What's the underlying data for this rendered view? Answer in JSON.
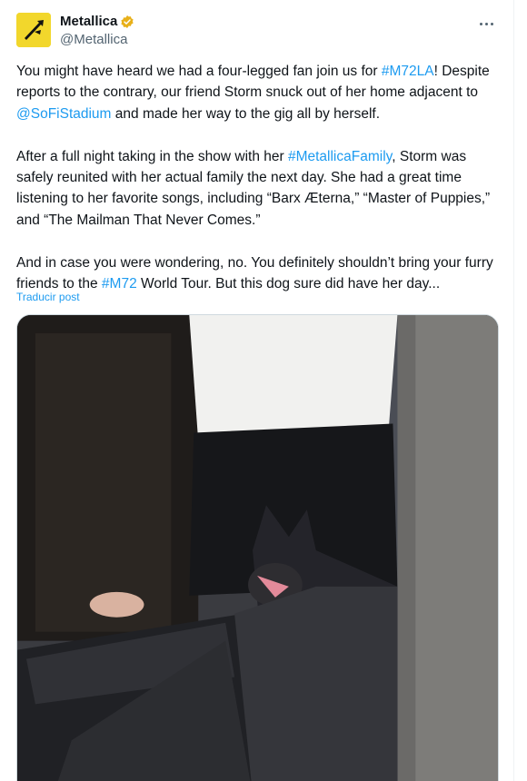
{
  "author": {
    "display_name": "Metallica",
    "handle": "@Metallica",
    "verified_icon": "verified-badge-icon",
    "avatar_icon": "metallica-logo-icon"
  },
  "more_icon": "more-options-icon",
  "tweet": {
    "p1": {
      "t1": "You might have heard we had a four-legged fan join us for ",
      "l1": "#M72LA",
      "t2": "! Despite reports to the contrary, our friend Storm snuck out of her home adjacent to ",
      "l2": "@SoFiStadium",
      "t3": " and made her way to the gig all by herself."
    },
    "p2": {
      "t1": "After a full night taking in the show with her ",
      "l1": "#MetallicaFamily",
      "t2": ", Storm was safely reunited with her actual family the next day. She had a great time listening to her favorite songs, including “Barx Æterna,” “Master of Puppies,” and “The Mailman That Never Comes.”"
    },
    "p3": {
      "t1": "And in case you were wondering, no. You definitely shouldn’t bring your furry friends to the ",
      "l1": "#M72",
      "t2": " World Tour. But this dog sure did have her day..."
    }
  },
  "translate_label": "Traducir post",
  "colors": {
    "link": "#1d9bf0",
    "secondary_text": "#536471",
    "avatar_bg": "#f2d72c",
    "verified": "#e8b019"
  }
}
